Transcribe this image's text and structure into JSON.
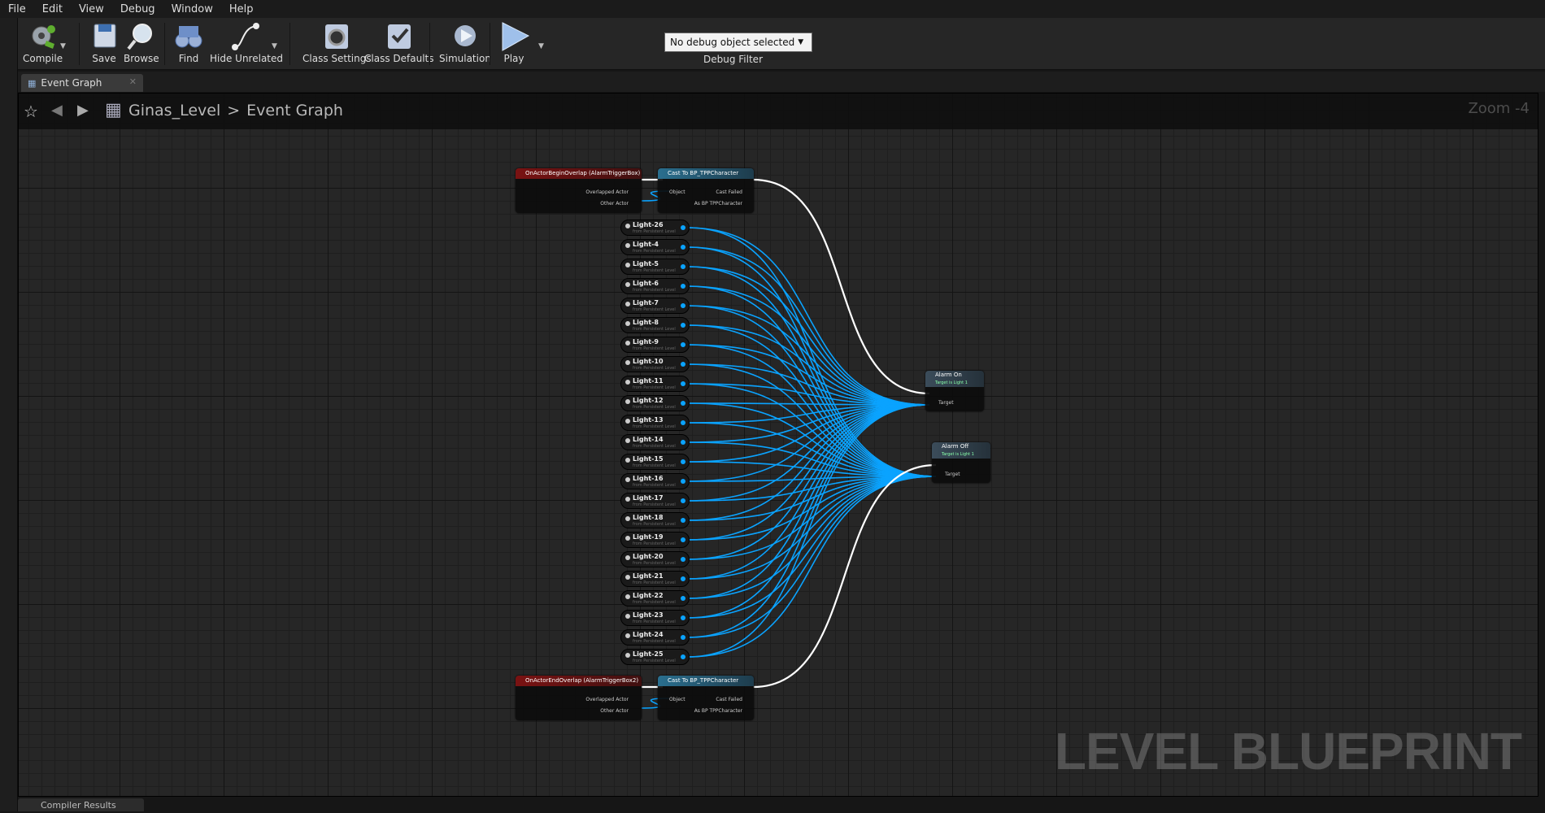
{
  "menu": [
    "File",
    "Edit",
    "View",
    "Debug",
    "Window",
    "Help"
  ],
  "toolbar": {
    "compile": "Compile",
    "save": "Save",
    "browse": "Browse",
    "find": "Find",
    "hide_unrelated": "Hide Unrelated",
    "class_settings": "Class Settings",
    "class_defaults": "Class Defaults",
    "simulation": "Simulation",
    "play": "Play",
    "debug_selected": "No debug object selected",
    "debug_filter": "Debug Filter"
  },
  "tab": {
    "label": "Event Graph"
  },
  "breadcrumb": {
    "level": "Ginas_Level",
    "separator": ">",
    "graph": "Event Graph"
  },
  "zoom": "Zoom -4",
  "watermark": "LEVEL BLUEPRINT",
  "bottom_tab": "Compiler Results",
  "nodes": {
    "begin_overlap": {
      "title": "OnActorBeginOverlap (AlarmTriggerBox)",
      "pins": [
        "Overlapped Actor",
        "Other Actor"
      ]
    },
    "cast_top": {
      "title": "Cast To BP_TPPCharacter",
      "pins": [
        "Object",
        "Cast Failed",
        "As BP TPPCharacter"
      ]
    },
    "end_overlap": {
      "title": "OnActorEndOverlap (AlarmTriggerBox2)",
      "pins": [
        "Overlapped Actor",
        "Other Actor"
      ]
    },
    "cast_bottom": {
      "title": "Cast To BP_TPPCharacter",
      "pins": [
        "Object",
        "Cast Failed",
        "As BP TPPCharacter"
      ]
    },
    "alarm_on": {
      "title": "Alarm On",
      "subtitle": "Target is Light 1",
      "pin": "Target"
    },
    "alarm_off": {
      "title": "Alarm Off",
      "subtitle": "Target is Light 1",
      "pin": "Target"
    }
  },
  "light_sub": "from Persistent Level",
  "lights": [
    "Light-26",
    "Light-4",
    "Light-5",
    "Light-6",
    "Light-7",
    "Light-8",
    "Light-9",
    "Light-10",
    "Light-11",
    "Light-12",
    "Light-13",
    "Light-14",
    "Light-15",
    "Light-16",
    "Light-17",
    "Light-18",
    "Light-19",
    "Light-20",
    "Light-21",
    "Light-22",
    "Light-23",
    "Light-24",
    "Light-25"
  ],
  "colors": {
    "event_header": "#7a1212",
    "func_header": "#3b4c5a",
    "cast_header": "#2a6f8f",
    "wire_object": "#0aa3ff",
    "wire_exec": "#ffffff"
  }
}
